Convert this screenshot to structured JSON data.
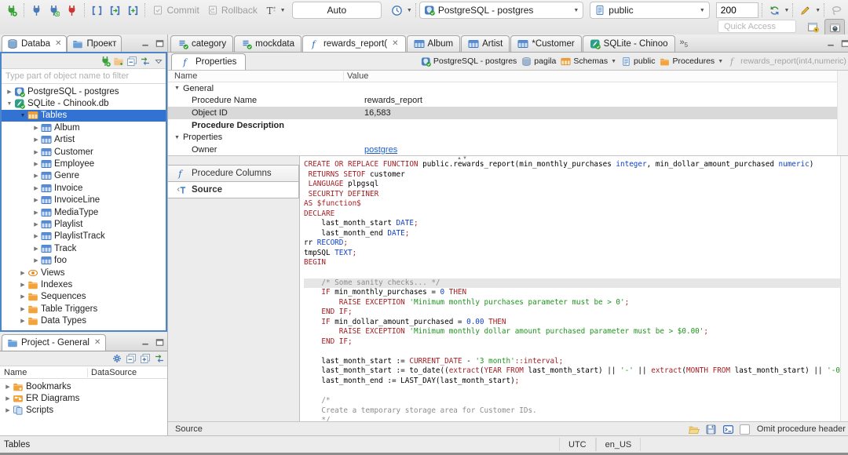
{
  "colors": {
    "sel": "#3272d2",
    "focus": "#4a86c9",
    "link": "#1d5fc4",
    "kw": "#a41e22",
    "typ": "#1040c8",
    "str": "#1f941f",
    "com": "#8c8c8c",
    "folder_orange": "#f2a33c",
    "icon_blue": "#3f6fb5",
    "connect_green": "#27a027",
    "disconnect_red": "#cc3333"
  },
  "toolbar": {
    "commit_label": "Commit",
    "rollback_label": "Rollback",
    "auto_value": "Auto",
    "connection_value": "PostgreSQL - postgres",
    "schema_value": "public",
    "fetch_size_value": "200",
    "quick_access_placeholder": "Quick Access"
  },
  "sidebar": {
    "tabs": [
      {
        "label": "Databa",
        "icon": "database",
        "active": true,
        "closable": true
      },
      {
        "label": "Проект",
        "icon": "folderblue"
      }
    ],
    "filter_placeholder": "Type part of object name to filter",
    "tree": [
      {
        "label": "PostgreSQL - postgres",
        "icon": "pgconn",
        "depth": 0,
        "expander": "collapsed"
      },
      {
        "label": "SQLite - Chinook.db",
        "icon": "sqlite",
        "depth": 0,
        "expander": "expanded"
      },
      {
        "label": "Tables",
        "icon": "tables",
        "depth": 1,
        "expander": "expanded",
        "selected": true
      },
      {
        "label": "Album",
        "icon": "table",
        "depth": 2,
        "expander": "collapsed"
      },
      {
        "label": "Artist",
        "icon": "table",
        "depth": 2,
        "expander": "collapsed"
      },
      {
        "label": "Customer",
        "icon": "table",
        "depth": 2,
        "expander": "collapsed"
      },
      {
        "label": "Employee",
        "icon": "table",
        "depth": 2,
        "expander": "collapsed"
      },
      {
        "label": "Genre",
        "icon": "table",
        "depth": 2,
        "expander": "collapsed"
      },
      {
        "label": "Invoice",
        "icon": "table",
        "depth": 2,
        "expander": "collapsed"
      },
      {
        "label": "InvoiceLine",
        "icon": "table",
        "depth": 2,
        "expander": "collapsed"
      },
      {
        "label": "MediaType",
        "icon": "table",
        "depth": 2,
        "expander": "collapsed"
      },
      {
        "label": "Playlist",
        "icon": "table",
        "depth": 2,
        "expander": "collapsed"
      },
      {
        "label": "PlaylistTrack",
        "icon": "table",
        "depth": 2,
        "expander": "collapsed"
      },
      {
        "label": "Track",
        "icon": "table",
        "depth": 2,
        "expander": "collapsed"
      },
      {
        "label": "foo",
        "icon": "table",
        "depth": 2,
        "expander": "collapsed"
      },
      {
        "label": "Views",
        "icon": "eye",
        "depth": 1,
        "expander": "collapsed"
      },
      {
        "label": "Indexes",
        "icon": "folder",
        "depth": 1,
        "expander": "collapsed"
      },
      {
        "label": "Sequences",
        "icon": "folder",
        "depth": 1,
        "expander": "collapsed"
      },
      {
        "label": "Table Triggers",
        "icon": "folder",
        "depth": 1,
        "expander": "collapsed"
      },
      {
        "label": "Data Types",
        "icon": "folder",
        "depth": 1,
        "expander": "collapsed"
      }
    ]
  },
  "project_panel": {
    "title": "Project - General",
    "columns": [
      "Name",
      "DataSource"
    ],
    "items": [
      {
        "label": "Bookmarks",
        "icon": "bookmarks"
      },
      {
        "label": "ER Diagrams",
        "icon": "er"
      },
      {
        "label": "Scripts",
        "icon": "scripts"
      }
    ]
  },
  "editor": {
    "tabs": [
      {
        "label": "category",
        "icon": "script"
      },
      {
        "label": "mockdata",
        "icon": "script"
      },
      {
        "label": "rewards_report(",
        "icon": "fn",
        "active": true,
        "closable": true
      },
      {
        "label": "Album",
        "icon": "table"
      },
      {
        "label": "Artist",
        "icon": "table"
      },
      {
        "label": "*Customer",
        "icon": "table"
      },
      {
        "label": "SQLite - Chinoo",
        "icon": "sqlite"
      }
    ],
    "overflow_count": "5",
    "subtab": "Properties",
    "breadcrumb": [
      {
        "label": "PostgreSQL - postgres",
        "icon": "pgconn"
      },
      {
        "label": "pagila",
        "icon": "dbcyl"
      },
      {
        "label": "Schemas",
        "icon": "schemas",
        "dropdown": true
      },
      {
        "label": "public",
        "icon": "page"
      },
      {
        "label": "Procedures",
        "icon": "folder",
        "dropdown": true
      },
      {
        "label": "rewards_report(int4,numeric)",
        "icon": "fnm",
        "muted": true
      }
    ],
    "properties": {
      "columns": [
        "Name",
        "Value"
      ],
      "rows": [
        {
          "name": "General",
          "value": "",
          "group": true
        },
        {
          "name": "Procedure Name",
          "value": "rewards_report",
          "indent": true
        },
        {
          "name": "Object ID",
          "value": "16,583",
          "indent": true,
          "selected": true
        },
        {
          "name": "Procedure Description",
          "value": "",
          "indent": true,
          "bold": true
        },
        {
          "name": "Properties",
          "value": "",
          "group": true
        },
        {
          "name": "Owner",
          "value": "postgres",
          "indent": true,
          "link": true
        }
      ]
    },
    "side_tabs": [
      {
        "label": "Procedure Columns",
        "icon": "fn"
      },
      {
        "label": "Source",
        "icon": "source",
        "active": true
      }
    ],
    "footer": {
      "label": "Source",
      "checkbox_label": "Omit procedure header",
      "checkbox_checked": false
    }
  },
  "source_code": {
    "highlighted_line": 12,
    "lines": [
      [
        [
          "k",
          "CREATE OR REPLACE FUNCTION"
        ],
        [
          "p",
          " public.rewards_report(min_monthly_purchases "
        ],
        [
          "t",
          "integer"
        ],
        [
          "p",
          ", min_dollar_amount_purchased "
        ],
        [
          "t",
          "numeric"
        ],
        [
          "p",
          ")"
        ]
      ],
      [
        [
          "p",
          " "
        ],
        [
          "k",
          "RETURNS SETOF"
        ],
        [
          "p",
          " customer"
        ]
      ],
      [
        [
          "p",
          " "
        ],
        [
          "k",
          "LANGUAGE"
        ],
        [
          "p",
          " plpgsql"
        ]
      ],
      [
        [
          "p",
          " "
        ],
        [
          "k",
          "SECURITY DEFINER"
        ]
      ],
      [
        [
          "k",
          "AS $function$"
        ]
      ],
      [
        [
          "k",
          "DECLARE"
        ]
      ],
      [
        [
          "p",
          "    last_month_start "
        ],
        [
          "t",
          "DATE"
        ],
        [
          "k",
          ";"
        ]
      ],
      [
        [
          "p",
          "    last_month_end "
        ],
        [
          "t",
          "DATE"
        ],
        [
          "k",
          ";"
        ]
      ],
      [
        [
          "p",
          "rr "
        ],
        [
          "t",
          "RECORD"
        ],
        [
          "k",
          ";"
        ]
      ],
      [
        [
          "p",
          "tmpSQL "
        ],
        [
          "t",
          "TEXT"
        ],
        [
          "k",
          ";"
        ]
      ],
      [
        [
          "k",
          "BEGIN"
        ]
      ],
      [],
      [
        [
          "c",
          "    /* Some sanity checks... */"
        ]
      ],
      [
        [
          "k",
          "    IF"
        ],
        [
          "p",
          " min_monthly_purchases = "
        ],
        [
          "n",
          "0"
        ],
        [
          "k",
          " THEN"
        ]
      ],
      [
        [
          "k",
          "        RAISE EXCEPTION"
        ],
        [
          "p",
          " "
        ],
        [
          "s",
          "'Minimum monthly purchases parameter must be > 0'"
        ],
        [
          "k",
          ";"
        ]
      ],
      [
        [
          "k",
          "    END IF;"
        ]
      ],
      [
        [
          "k",
          "    IF"
        ],
        [
          "p",
          " min_dollar_amount_purchased = "
        ],
        [
          "n",
          "0.00"
        ],
        [
          "k",
          " THEN"
        ]
      ],
      [
        [
          "k",
          "        RAISE EXCEPTION"
        ],
        [
          "p",
          " "
        ],
        [
          "s",
          "'Minimum monthly dollar amount purchased parameter must be > $0.00'"
        ],
        [
          "k",
          ";"
        ]
      ],
      [
        [
          "k",
          "    END IF;"
        ]
      ],
      [],
      [
        [
          "p",
          "    last_month_start := "
        ],
        [
          "k",
          "CURRENT_DATE"
        ],
        [
          "p",
          " - "
        ],
        [
          "s",
          "'3 month'"
        ],
        [
          "k",
          "::interval;"
        ]
      ],
      [
        [
          "p",
          "    last_month_start := to_date(("
        ],
        [
          "k",
          "extract"
        ],
        [
          "p",
          "("
        ],
        [
          "k",
          "YEAR FROM"
        ],
        [
          "p",
          " last_month_start) || "
        ],
        [
          "s",
          "'-'"
        ],
        [
          "p",
          " || "
        ],
        [
          "k",
          "extract"
        ],
        [
          "p",
          "("
        ],
        [
          "k",
          "MONTH FROM"
        ],
        [
          "p",
          " last_month_start) || "
        ],
        [
          "s",
          "'-0"
        ]
      ],
      [
        [
          "p",
          "    last_month_end := LAST_DAY(last_month_start)"
        ],
        [
          "k",
          ";"
        ]
      ],
      [],
      [
        [
          "c",
          "    /*"
        ]
      ],
      [
        [
          "c",
          "    Create a temporary storage area for Customer IDs."
        ]
      ],
      [
        [
          "c",
          "    */"
        ]
      ]
    ]
  },
  "statusbar": {
    "left": "Tables",
    "timezone": "UTC",
    "locale": "en_US"
  }
}
